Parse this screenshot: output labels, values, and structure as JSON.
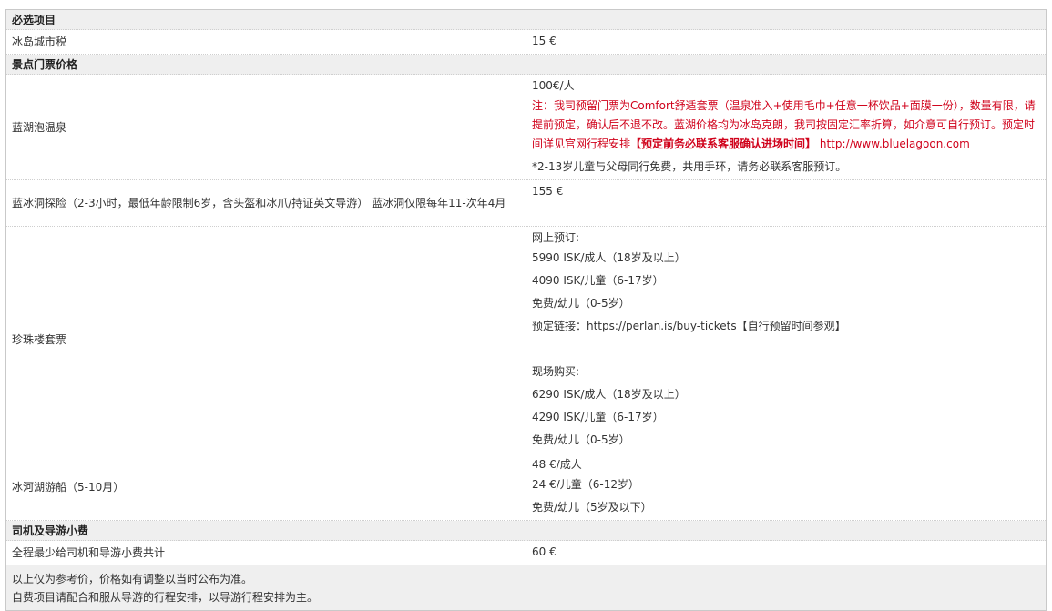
{
  "sections": {
    "required": {
      "title": "必选项目",
      "rows": [
        {
          "name": "冰岛城市税",
          "value": "15 €"
        }
      ]
    },
    "tickets": {
      "title": "景点门票价格",
      "blue_lagoon": {
        "name": "蓝湖泡温泉",
        "price": "100€/人",
        "note_part1": "注：我司预留门票为Comfort舒适套票（温泉准入+使用毛巾+任意一杯饮品+面膜一份），数量有限，请提前预定，确认后不退不改。蓝湖价格均为冰岛克朗，我司按固定汇率折算，如介意可自行预订。预定时间详见官网行程安排",
        "note_bold": "【预定前务必联系客服确认进场时间】",
        "note_url": "http://www.bluelagoon.com",
        "child_note": "*2-13岁儿童与父母同行免费，共用手环，请务必联系客服预订。"
      },
      "ice_cave": {
        "name": "蓝冰洞探险（2-3小时，最低年龄限制6岁，含头盔和冰爪/持证英文导游） 蓝冰洞仅限每年11-次年4月",
        "price": "155 €"
      },
      "perlan": {
        "name": "珍珠楼套票",
        "lines": [
          "网上预订:",
          "5990 ISK/成人（18岁及以上）",
          "4090 ISK/儿童（6-17岁）",
          "免费/幼儿（0-5岁）",
          "预定链接：https://perlan.is/buy-tickets【自行预留时间参观】",
          "",
          "现场购买:",
          "6290 ISK/成人（18岁及以上）",
          "4290 ISK/儿童（6-17岁）",
          "免费/幼儿（0-5岁）"
        ]
      },
      "boat": {
        "name": "冰河湖游船（5-10月）",
        "lines": [
          "48 €/成人",
          "24 €/儿童（6-12岁）",
          "免费/幼儿（5岁及以下）"
        ]
      }
    },
    "tips": {
      "title": "司机及导游小费",
      "rows": [
        {
          "name": "全程最少给司机和导游小费共计",
          "value": "60 €"
        }
      ]
    }
  },
  "footer_notes": [
    "以上仅为参考价，价格如有调整以当时公布为准。",
    "自费项目请配合和服从导游的行程安排，以导游行程安排为主。"
  ],
  "colors": {
    "section_bg": "#efefef",
    "accent_red": "#d0021b",
    "border": "#c9c9c9"
  }
}
